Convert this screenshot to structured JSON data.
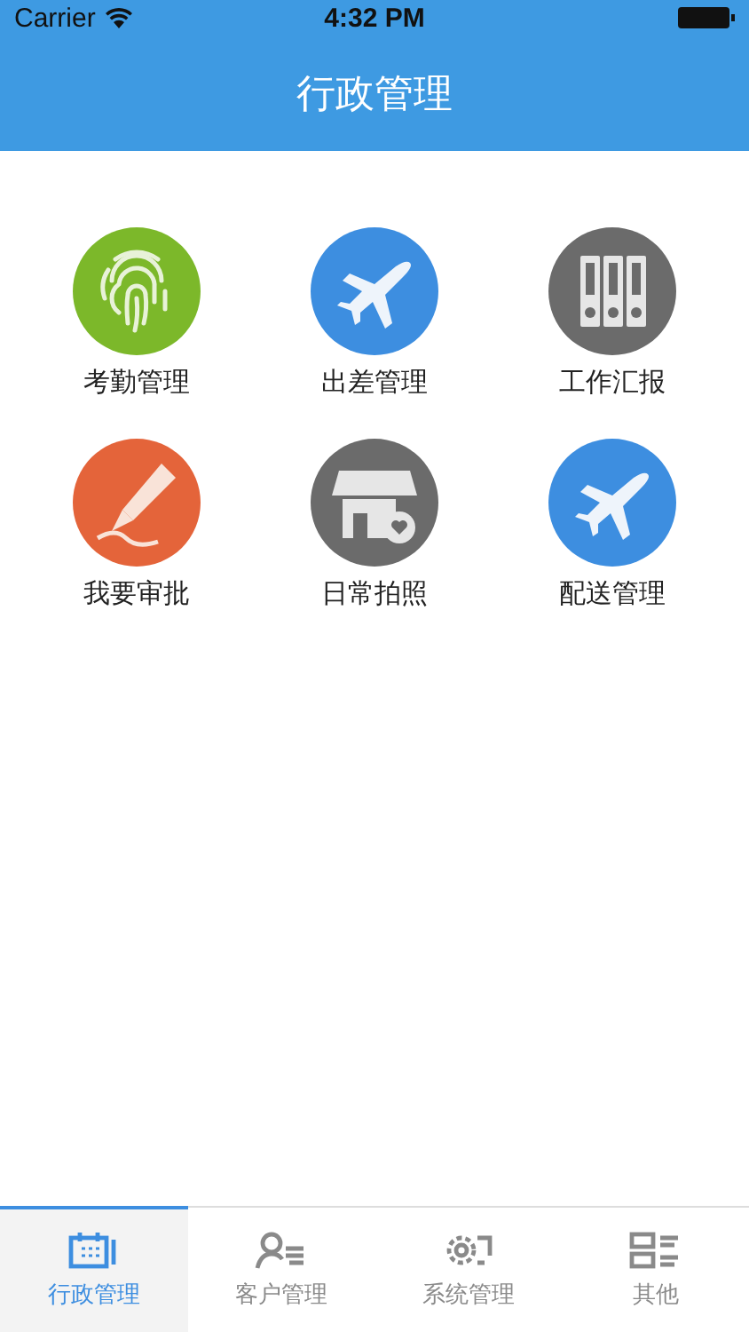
{
  "status_bar": {
    "carrier": "Carrier",
    "time": "4:32 PM"
  },
  "nav": {
    "title": "行政管理"
  },
  "modules": [
    {
      "label": "考勤管理",
      "kind": "fingerprint",
      "color": "#7cb82a"
    },
    {
      "label": "出差管理",
      "kind": "plane",
      "color": "#3d8ee0"
    },
    {
      "label": "工作汇报",
      "kind": "binders",
      "color": "#6b6b6b"
    },
    {
      "label": "我要审批",
      "kind": "pen",
      "color": "#e4643a"
    },
    {
      "label": "日常拍照",
      "kind": "shop",
      "color": "#6b6b6b"
    },
    {
      "label": "配送管理",
      "kind": "plane",
      "color": "#3d8ee0"
    }
  ],
  "tabs": [
    {
      "label": "行政管理",
      "kind": "calendar",
      "selected": true
    },
    {
      "label": "客户管理",
      "kind": "contacts",
      "selected": false
    },
    {
      "label": "系统管理",
      "kind": "gear",
      "selected": false
    },
    {
      "label": "其他",
      "kind": "list",
      "selected": false
    }
  ]
}
